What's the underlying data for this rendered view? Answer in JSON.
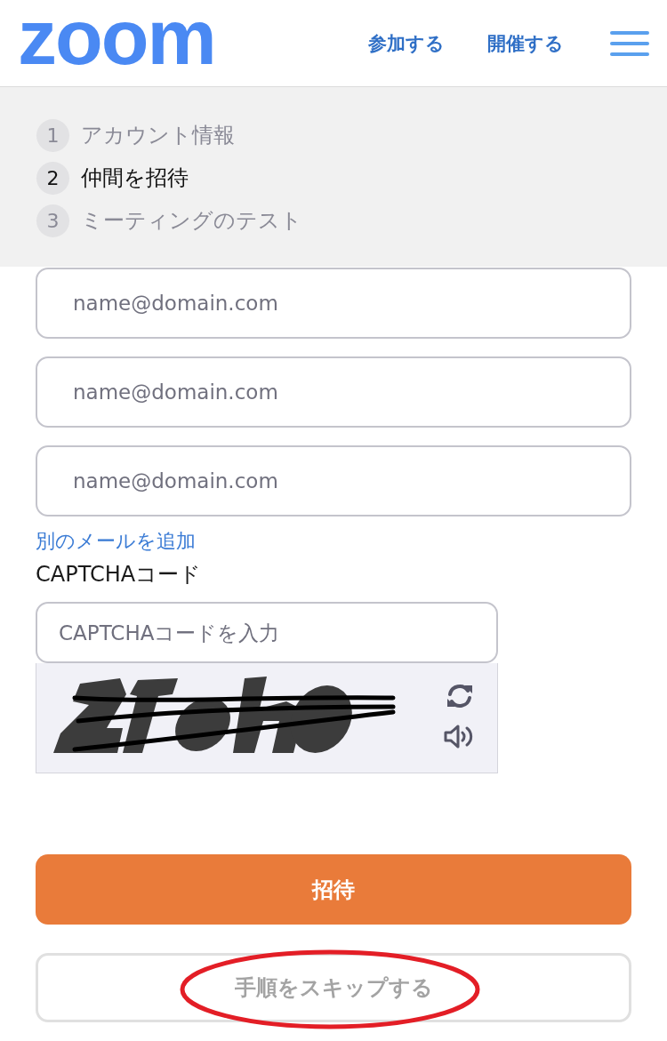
{
  "header": {
    "logo": "zoom",
    "nav_links": [
      "参加する",
      "開催する"
    ]
  },
  "steps": [
    {
      "number": "1",
      "label": "アカウント情報",
      "selected": false
    },
    {
      "number": "2",
      "label": "仲間を招待",
      "selected": true
    },
    {
      "number": "3",
      "label": "ミーティングのテスト",
      "selected": false
    }
  ],
  "invite_fields": [
    {
      "placeholder": "name@domain.com"
    },
    {
      "placeholder": "name@domain.com"
    },
    {
      "placeholder": "name@domain.com"
    }
  ],
  "add_email_link": "別のメールを追加",
  "captcha": {
    "label": "CAPTCHAコード",
    "placeholder": "CAPTCHAコードを入力"
  },
  "buttons": [
    {
      "label": "招待",
      "kind": "primary",
      "highlighted": false
    },
    {
      "label": "手順をスキップする",
      "kind": "secondary",
      "highlighted": true
    }
  ]
}
